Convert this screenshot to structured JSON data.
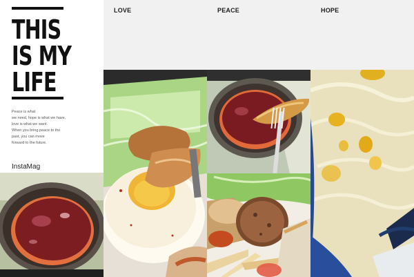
{
  "title_lines": [
    "THIS",
    "IS MY",
    "LIFE"
  ],
  "quote_lines": [
    "Peace is what",
    "we need, hope is what we have,",
    "love is what we want.",
    "When you bring peace to the",
    "past, you can move",
    "forward to the future."
  ],
  "brand": "InstaMag",
  "columns": [
    {
      "label": "LOVE"
    },
    {
      "label": "PEACE"
    },
    {
      "label": "HOPE"
    }
  ],
  "photos": [
    {
      "subject": "bowl-of-sauce"
    },
    {
      "subject": "fried-egg-chicken-lettuce"
    },
    {
      "subject": "sauce-bowl-with-potato-and-fork"
    },
    {
      "subject": "hamburg-steak-with-fries"
    },
    {
      "subject": "corn-egg-drop-soup"
    }
  ]
}
